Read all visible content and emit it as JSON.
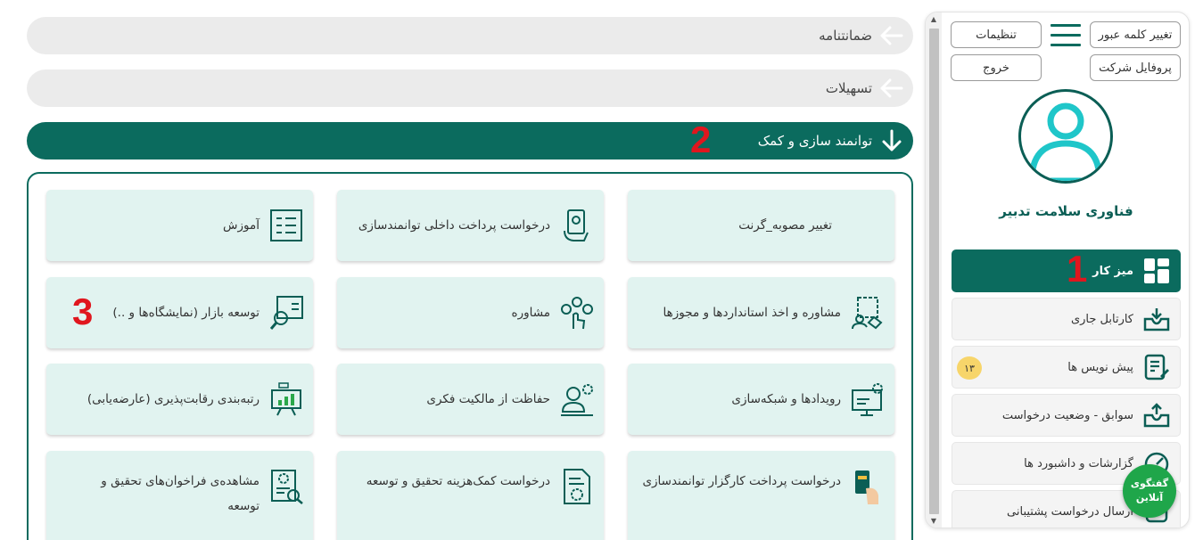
{
  "sidebar": {
    "buttons": {
      "change_password": "تغییر کلمه عبور",
      "settings": "تنظیمات",
      "company_profile": "پروفایل شرکت",
      "logout": "خروج"
    },
    "company_name": "فناوری سلامت تدبیر",
    "nav_items": [
      {
        "label": "میز کار",
        "icon": "dashboard-grid-icon",
        "active": true
      },
      {
        "label": "کارتابل جاری",
        "icon": "inbox-tray-icon"
      },
      {
        "label": "پیش نویس ها",
        "icon": "draft-edit-icon",
        "badge": "۱۳"
      },
      {
        "label": "سوابق - وضعیت درخواست",
        "icon": "upload-tray-icon"
      },
      {
        "label": "گزارشات و داشبورد ها",
        "icon": "gauge-icon"
      },
      {
        "label": "ارسال درخواست پشتیبانی",
        "icon": "support-icon"
      }
    ],
    "chat": {
      "line1": "گفتگوی",
      "line2": "آنلاین"
    }
  },
  "accordions": [
    {
      "label": "ضمانتنامه",
      "state": "collapsed"
    },
    {
      "label": "تسهیلات",
      "state": "collapsed"
    },
    {
      "label": "توانمند سازی و کمک",
      "state": "expanded"
    }
  ],
  "markers": [
    "1",
    "2",
    "3"
  ],
  "cards": [
    {
      "label": "تغییر مصوبه_گرنت",
      "icon": "none"
    },
    {
      "label": "درخواست پرداخت داخلی توانمندسازی",
      "icon": "payment-hand-icon"
    },
    {
      "label": "آموزش",
      "icon": "checklist-icon"
    },
    {
      "label": "مشاوره و اخذ استانداردها و مجوزها",
      "icon": "consulting-handshake-icon"
    },
    {
      "label": "مشاوره",
      "icon": "hand-gears-icon"
    },
    {
      "label": "توسعه بازار (نمایشگاه‌ها و ..)",
      "icon": "market-search-icon"
    },
    {
      "label": "رویدادها و شبکه‌سازی",
      "icon": "monitor-gear-icon"
    },
    {
      "label": "حفاظت از مالکیت فکری",
      "icon": "ip-person-gear-icon"
    },
    {
      "label": "رتبه‌بندی رقابت‌پذیری (عارضه‌یابی)",
      "icon": "presentation-chart-icon"
    },
    {
      "label": "درخواست پرداخت کارگزار توانمندسازی",
      "icon": "card-hand-icon"
    },
    {
      "label": "درخواست کمک‌هزینه تحقیق و توسعه",
      "icon": "document-gear-icon"
    },
    {
      "label": "مشاهده‌ی فراخوان‌های تحقیق و توسعه",
      "icon": "document-search-icon"
    }
  ],
  "colors": {
    "primary": "#0b6b5e",
    "card_bg": "#e1f3f0",
    "accordion_bg": "#ebebeb",
    "marker": "#e0161e",
    "badge": "#f7d56a",
    "chat": "#1fa64a"
  }
}
